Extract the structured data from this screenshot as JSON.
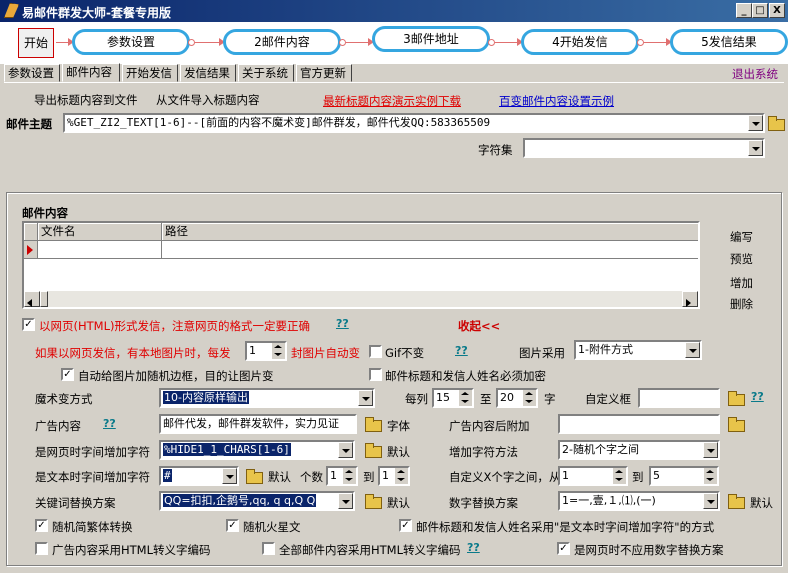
{
  "window": {
    "title": "易邮件群发大师-套餐专用版",
    "min": "_",
    "max": "□",
    "close": "X"
  },
  "wizard": {
    "start": "开始",
    "steps": [
      "参数设置",
      "2邮件内容",
      "3邮件地址",
      "4开始发信",
      "5发信结果"
    ]
  },
  "tabs": [
    "参数设置",
    "邮件内容",
    "开始发信",
    "发信结果",
    "关于系统",
    "官方更新"
  ],
  "active_tab": "邮件内容",
  "exit_link": "退出系统",
  "links": {
    "export_title": "导出标题内容到文件",
    "import_title": "从文件导入标题内容",
    "latest_demo": "最新标题内容演示实例下载",
    "settings_demo": "百变邮件内容设置示例"
  },
  "subject": {
    "label": "邮件主题",
    "value": "%GET_ZI2_TEXT[1-6]--[前面的内容不魔术变]邮件群发，邮件代发QQ:583365509"
  },
  "charset": {
    "label": "字符集",
    "value": ""
  },
  "content": {
    "label": "邮件内容",
    "columns": [
      "文件名",
      "路径"
    ],
    "rows": [],
    "side_buttons": [
      "编写",
      "预览",
      "增加",
      "删除"
    ]
  },
  "options": {
    "html_send": {
      "checked": true,
      "label": "以网页(HTML)形式发信，注意网页的格式一定要正确",
      "help": "??"
    },
    "collapse": "收起<<",
    "local_img_prefix": "如果以网页发信，有本地图片时，每发",
    "local_img_value": "1",
    "local_img_suffix": "封图片自动变",
    "gif_no_change": {
      "checked": false,
      "label": "Gif不变",
      "help": "??"
    },
    "img_use_label": "图片采用",
    "img_use_value": "1-附件方式",
    "random_border": {
      "checked": true,
      "label": "自动给图片加随机边框，目的让图片变"
    },
    "encrypt_title": {
      "checked": false,
      "label": "邮件标题和发信人姓名必须加密"
    },
    "magic_label": "魔术变方式",
    "magic_value": "10-内容原样输出",
    "per_row_label": "每列",
    "per_row_from": "15",
    "per_row_to_label": "至",
    "per_row_to": "20",
    "per_row_unit": "字",
    "custom_box_label": "自定义框",
    "custom_box_value": "",
    "custom_box_help": "??",
    "ad_label": "广告内容",
    "ad_help": "??",
    "ad_value": "邮件代发，邮件群发软件，实力见证",
    "font_label": "字体",
    "ad_append_label": "广告内容后附加",
    "ad_append_value": "",
    "web_add_label": "是网页时字间增加字符",
    "web_add_value": "%HIDE1_1_CHARS[1-6]",
    "default_label": "默认",
    "add_method_label": "增加字符方法",
    "add_method_value": "2-随机个字之间",
    "text_add_label": "是文本时字间增加字符",
    "text_add_value": "#",
    "count_label": "个数",
    "count_from": "1",
    "count_to_label": "到",
    "count_to": "1",
    "custom_x_label": "自定义X个字之间，从",
    "custom_x_from": "1",
    "custom_x_to_label": "到",
    "custom_x_to": "5",
    "keyword_label": "关键词替换方案",
    "keyword_value": "QQ=扣扣,企鹅号,qq, q q,Q Q",
    "num_replace_label": "数字替换方案",
    "num_replace_value": "1=一,壹,１,⑴,(一)",
    "random_trad": {
      "checked": true,
      "label": "随机简繁体转换"
    },
    "random_mars": {
      "checked": true,
      "label": "随机火星文"
    },
    "title_use_text": {
      "checked": true,
      "label": "邮件标题和发信人姓名采用\"是文本时字间增加字符\"的方式"
    },
    "ad_html_escape": {
      "checked": false,
      "label": "广告内容采用HTML转义字编码"
    },
    "all_html_escape": {
      "checked": false,
      "label": "全部邮件内容采用HTML转义字编码",
      "help": "??"
    },
    "web_no_num": {
      "checked": true,
      "label": "是网页时不应用数字替换方案"
    }
  },
  "colors": {
    "title_start": "#0a246a",
    "title_end": "#3a6ea5",
    "step_border": "#35a6e0",
    "accent_red": "#e00000",
    "link_blue": "#0000cc"
  }
}
